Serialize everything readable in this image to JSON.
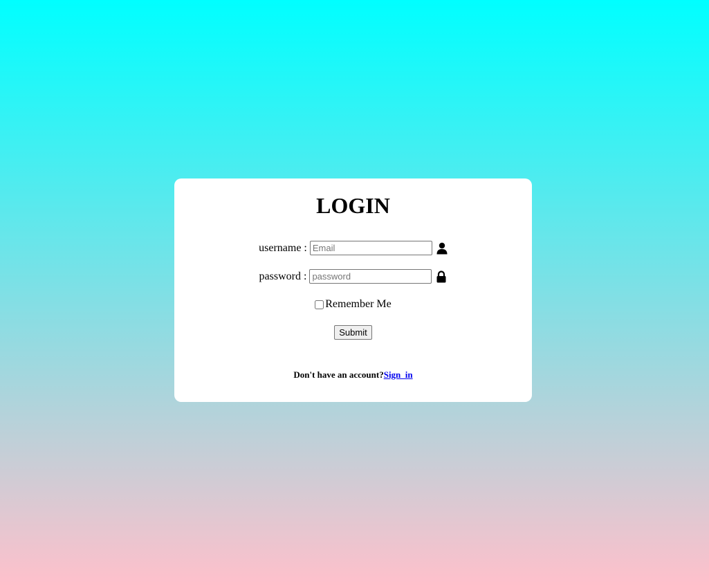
{
  "login_form": {
    "title": "LOGIN",
    "username_label": "username :",
    "username_placeholder": "Email",
    "password_label": "password :",
    "password_placeholder": "password",
    "remember_label": "Remember Me",
    "submit_label": "Submit",
    "signup_prompt": "Don't have an account?",
    "signup_link": "Sign_in"
  },
  "icons": {
    "username": "user-icon",
    "password": "lock-icon"
  },
  "colors": {
    "gradient_top": "#00ffff",
    "gradient_bottom": "#ffc0cb",
    "card": "#ffffff",
    "link": "#0000ee"
  }
}
